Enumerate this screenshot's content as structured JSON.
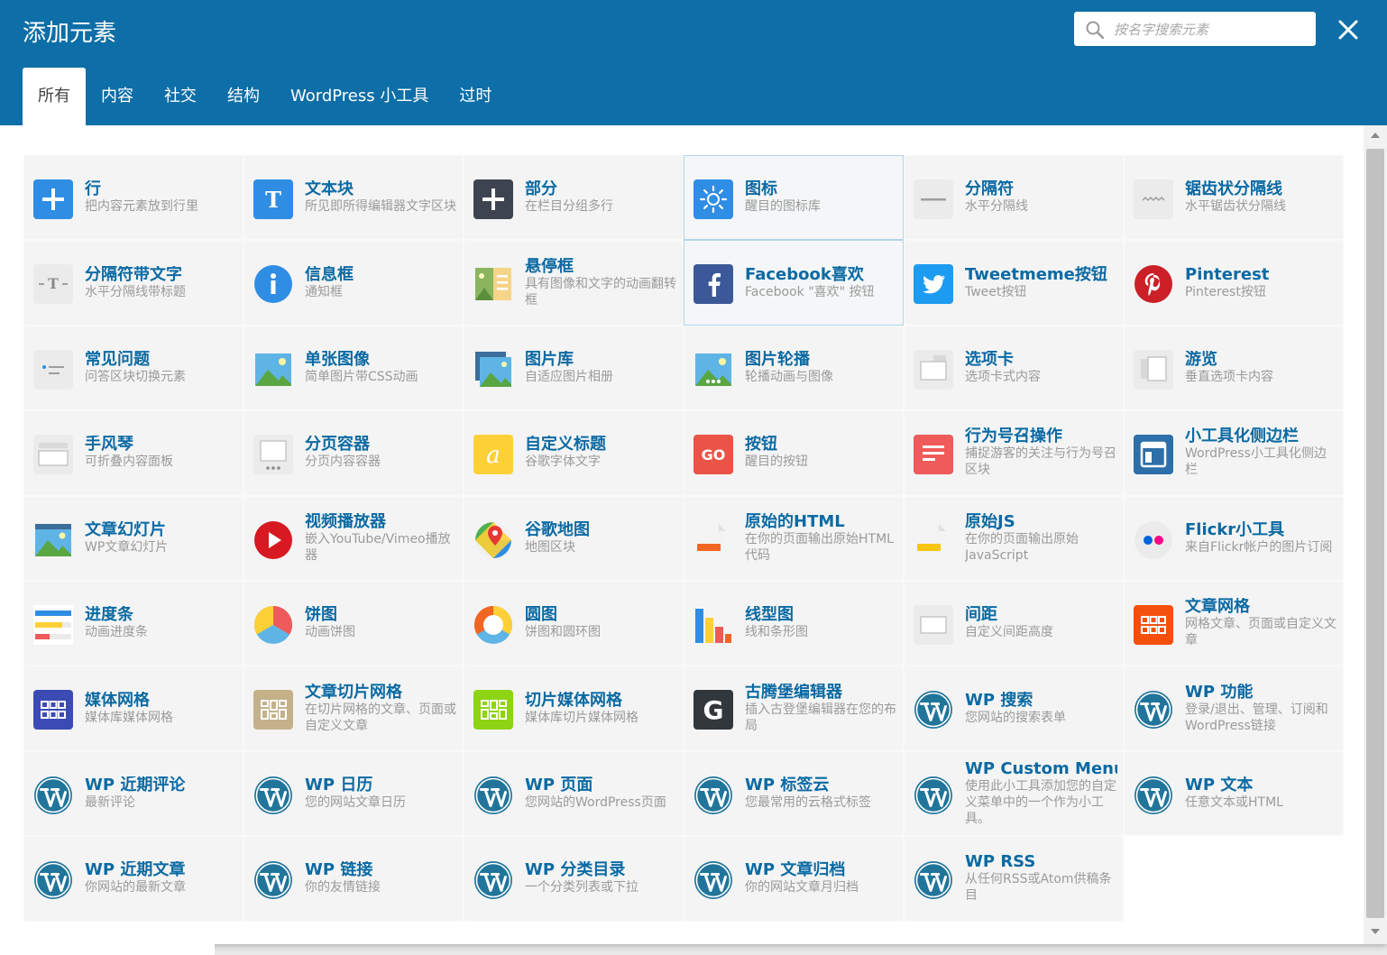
{
  "header": {
    "title": "添加元素",
    "search_placeholder": "按名字搜索元素",
    "search_value": ""
  },
  "tabs": [
    {
      "label": "所有",
      "active": true
    },
    {
      "label": "内容",
      "active": false
    },
    {
      "label": "社交",
      "active": false
    },
    {
      "label": "结构",
      "active": false
    },
    {
      "label": "WordPress 小工具",
      "active": false
    },
    {
      "label": "过时",
      "active": false
    }
  ],
  "elements": [
    {
      "name": "行",
      "desc": "把内容元素放到行里",
      "icon": "plus-icon",
      "color": "#2f8de4"
    },
    {
      "name": "文本块",
      "desc": "所见即所得编辑器文字区块",
      "icon": "text-t-icon",
      "color": "#2f8de4"
    },
    {
      "name": "部分",
      "desc": "在栏目分组多行",
      "icon": "plus-dark-icon",
      "color": "#3d4450"
    },
    {
      "name": "图标",
      "desc": "醒目的图标库",
      "icon": "sun-icon",
      "color": "#2f8de4"
    },
    {
      "name": "分隔符",
      "desc": "水平分隔线",
      "icon": "separator-icon",
      "color": "#ebebeb"
    },
    {
      "name": "锯齿状分隔线",
      "desc": "水平锯齿状分隔线",
      "icon": "zigzag-icon",
      "color": "#ebebeb"
    },
    {
      "name": "分隔符带文字",
      "desc": "水平分隔线带标题",
      "icon": "text-separator-icon",
      "color": "#ebebeb"
    },
    {
      "name": "信息框",
      "desc": "通知框",
      "icon": "info-icon",
      "color": "#2f8de4"
    },
    {
      "name": "悬停框",
      "desc": "具有图像和文字的动画翻转框",
      "icon": "hoverbox-icon",
      "color": "#8ab55e"
    },
    {
      "name": "Facebook喜欢",
      "desc": "Facebook \"喜欢\" 按钮",
      "icon": "facebook-icon",
      "color": "#3b5998"
    },
    {
      "name": "Tweetmeme按钮",
      "desc": "Tweet按钮",
      "icon": "twitter-icon",
      "color": "#1d9bf0"
    },
    {
      "name": "Pinterest",
      "desc": "Pinterest按钮",
      "icon": "pinterest-icon",
      "color": "#cb2027"
    },
    {
      "name": "常见问题",
      "desc": "问答区块切换元素",
      "icon": "faq-icon",
      "color": "#ebebeb"
    },
    {
      "name": "单张图像",
      "desc": "简单图片带CSS动画",
      "icon": "image-icon",
      "color": "#5fb4e6"
    },
    {
      "name": "图片库",
      "desc": "自适应图片相册",
      "icon": "gallery-icon",
      "color": "#5fb4e6"
    },
    {
      "name": "图片轮播",
      "desc": "轮播动画与图像",
      "icon": "carousel-icon",
      "color": "#5fb4e6"
    },
    {
      "name": "选项卡",
      "desc": "选项卡式内容",
      "icon": "tabs-icon",
      "color": "#ebebeb"
    },
    {
      "name": "游览",
      "desc": "垂直选项卡内容",
      "icon": "tour-icon",
      "color": "#ebebeb"
    },
    {
      "name": "手风琴",
      "desc": "可折叠内容面板",
      "icon": "accordion-icon",
      "color": "#ebebeb"
    },
    {
      "name": "分页容器",
      "desc": "分页内容容器",
      "icon": "pageable-icon",
      "color": "#ebebeb"
    },
    {
      "name": "自定义标题",
      "desc": "谷歌字体文字",
      "icon": "custom-heading-icon",
      "color": "#fdd037"
    },
    {
      "name": "按钮",
      "desc": "醒目的按钮",
      "icon": "button-go-icon",
      "color": "#e95447"
    },
    {
      "name": "行为号召操作",
      "desc": "捕捉游客的关注与行为号召区块",
      "icon": "cta-icon",
      "color": "#ef5a5a"
    },
    {
      "name": "小工具化侧边栏",
      "desc": "WordPress小工具化侧边栏",
      "icon": "sidebar-icon",
      "color": "#2d6fa8"
    },
    {
      "name": "文章幻灯片",
      "desc": "WP文章幻灯片",
      "icon": "slideshow-icon",
      "color": "#5fb4e6"
    },
    {
      "name": "视频播放器",
      "desc": "嵌入YouTube/Vimeo播放器",
      "icon": "play-icon",
      "color": "#d71921"
    },
    {
      "name": "谷歌地图",
      "desc": "地图区块",
      "icon": "map-pin-icon",
      "color": "#4caf50"
    },
    {
      "name": "原始的HTML",
      "desc": "在你的页面输出原始HTML代码",
      "icon": "raw-html-icon",
      "color": "#f26522"
    },
    {
      "name": "原始JS",
      "desc": "在你的页面输出原始JavaScript",
      "icon": "raw-js-icon",
      "color": "#f9c513"
    },
    {
      "name": "Flickr小工具",
      "desc": "来自Flickr帐户的图片订阅",
      "icon": "flickr-icon",
      "color": "#ebebeb"
    },
    {
      "name": "进度条",
      "desc": "动画进度条",
      "icon": "progress-bar-icon",
      "color": "#ebebeb"
    },
    {
      "name": "饼图",
      "desc": "动画饼图",
      "icon": "pie-chart-icon",
      "color": "#fdd037"
    },
    {
      "name": "圆图",
      "desc": "饼图和圆环图",
      "icon": "donut-chart-icon",
      "color": "#f26522"
    },
    {
      "name": "线型图",
      "desc": "线和条形图",
      "icon": "bar-chart-icon",
      "color": "#2f8de4"
    },
    {
      "name": "间距",
      "desc": "自定义间距高度",
      "icon": "spacer-icon",
      "color": "#ebebeb"
    },
    {
      "name": "文章网格",
      "desc": "网格文章、页面或自定义文章",
      "icon": "post-grid-icon",
      "color": "#f54f0e"
    },
    {
      "name": "媒体网格",
      "desc": "媒体库媒体网格",
      "icon": "media-grid-icon",
      "color": "#3c4bb4"
    },
    {
      "name": "文章切片网格",
      "desc": "在切片网格的文章、页面或自定义文章",
      "icon": "masonry-grid-icon",
      "color": "#c4b18a"
    },
    {
      "name": "切片媒体网格",
      "desc": "媒体库切片媒体网格",
      "icon": "masonry-media-icon",
      "color": "#8dd414"
    },
    {
      "name": "古腾堡编辑器",
      "desc": "插入古登堡编辑器在您的布局",
      "icon": "gutenberg-icon",
      "color": "#32373c"
    },
    {
      "name": "WP 搜索",
      "desc": "您网站的搜索表单",
      "icon": "wordpress-icon",
      "color": "#21759b"
    },
    {
      "name": "WP 功能",
      "desc": "登录/退出、管理、订阅和WordPress链接",
      "icon": "wordpress-icon",
      "color": "#21759b"
    },
    {
      "name": "WP 近期评论",
      "desc": "最新评论",
      "icon": "wordpress-icon",
      "color": "#21759b"
    },
    {
      "name": "WP 日历",
      "desc": "您的网站文章日历",
      "icon": "wordpress-icon",
      "color": "#21759b"
    },
    {
      "name": "WP 页面",
      "desc": "您网站的WordPress页面",
      "icon": "wordpress-icon",
      "color": "#21759b"
    },
    {
      "name": "WP 标签云",
      "desc": "您最常用的云格式标签",
      "icon": "wordpress-icon",
      "color": "#21759b"
    },
    {
      "name": "WP Custom Menu",
      "desc": "使用此小工具添加您的自定义菜单中的一个作为小工具。",
      "icon": "wordpress-icon",
      "color": "#21759b"
    },
    {
      "name": "WP 文本",
      "desc": "任意文本或HTML",
      "icon": "wordpress-icon",
      "color": "#21759b"
    },
    {
      "name": "WP 近期文章",
      "desc": "你网站的最新文章",
      "icon": "wordpress-icon",
      "color": "#21759b"
    },
    {
      "name": "WP 链接",
      "desc": "你的友情链接",
      "icon": "wordpress-icon",
      "color": "#21759b"
    },
    {
      "name": "WP 分类目录",
      "desc": "一个分类列表或下拉",
      "icon": "wordpress-icon",
      "color": "#21759b"
    },
    {
      "name": "WP 文章归档",
      "desc": "你的网站文章月归档",
      "icon": "wordpress-icon",
      "color": "#21759b"
    },
    {
      "name": "WP RSS",
      "desc": "从任何RSS或Atom供稿条目",
      "icon": "wordpress-icon",
      "color": "#21759b"
    }
  ]
}
